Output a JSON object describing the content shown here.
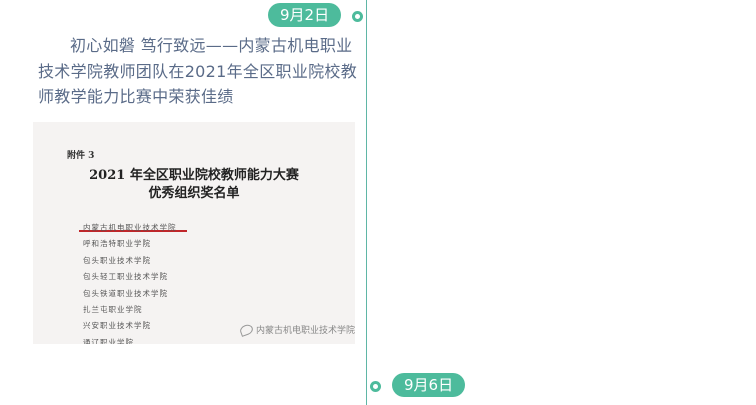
{
  "timeline": {
    "accent_color": "#4dbb9c",
    "entries": [
      {
        "date": "9月2日",
        "title": "初心如磐 笃行致远——内蒙古机电职业技术学院教师团队在2021年全区职业院校教师教学能力比赛中荣获佳绩",
        "image": {
          "attachment_label": "附件 3",
          "title_line1": "2021 年全区职业院校教师能力大赛",
          "title_line2": "优秀组织奖名单",
          "list": [
            "内蒙古机电职业技术学院",
            "呼和浩特职业学院",
            "包头职业技术学院",
            "包头轻工职业技术学院",
            "包头铁道职业技术学院",
            "扎兰屯职业学院",
            "兴安职业技术学院",
            "通辽职业学院"
          ],
          "watermark": "内蒙古机电职业技术学院"
        }
      },
      {
        "date": "9月6日"
      }
    ]
  }
}
